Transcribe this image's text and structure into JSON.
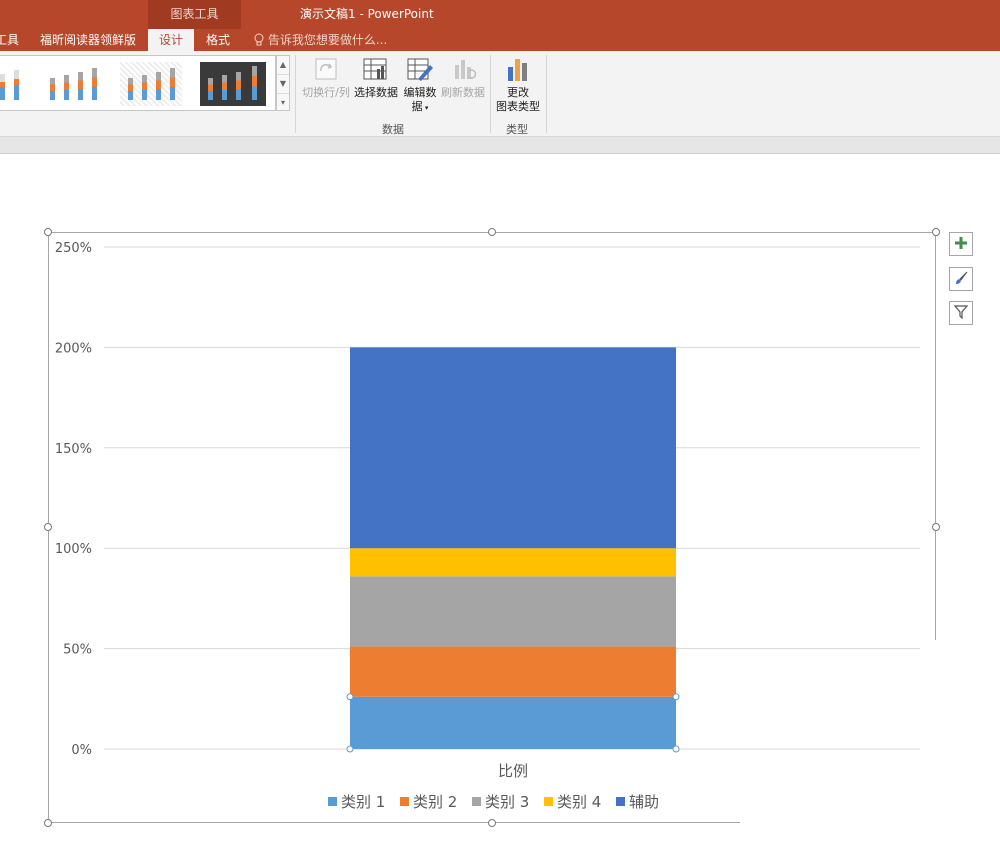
{
  "titlebar": {
    "context_group": "图表工具",
    "document_title": "演示文稿1 - PowerPoint"
  },
  "tabs": {
    "tools_partial": "工具",
    "foxit": "福昕阅读器领鲜版",
    "design": "设计",
    "format": "格式",
    "tell_me": "告诉我您想要做什么..."
  },
  "ribbon": {
    "switch_row_col": "切换行/列",
    "select_data": "选择数据",
    "edit_data_line1": "编辑数",
    "edit_data_line2": "据",
    "refresh_data": "刷新数据",
    "data_group": "数据",
    "change_type_line1": "更改",
    "change_type_line2": "图表类型",
    "type_group": "类型"
  },
  "icons": [
    "plus-icon",
    "brush-icon",
    "filter-icon",
    "lightbulb-icon"
  ],
  "colors": {
    "accent": "#b7472a",
    "series1": "#5b9bd5",
    "series2": "#ed7d31",
    "series3": "#a5a5a5",
    "series4": "#ffc000",
    "series5": "#4472c4"
  },
  "chart_data": {
    "type": "bar",
    "stacked": true,
    "categories": [
      "比例"
    ],
    "series": [
      {
        "name": "类别 1",
        "values": [
          0.26
        ]
      },
      {
        "name": "类别 2",
        "values": [
          0.25
        ]
      },
      {
        "name": "类别 3",
        "values": [
          0.35
        ]
      },
      {
        "name": "类别 4",
        "values": [
          0.14
        ]
      },
      {
        "name": "辅助",
        "values": [
          1.0
        ]
      }
    ],
    "ylim": [
      0,
      2.5
    ],
    "yticks": [
      "0%",
      "50%",
      "100%",
      "150%",
      "200%",
      "250%"
    ],
    "grid": true,
    "legend": "bottom"
  }
}
